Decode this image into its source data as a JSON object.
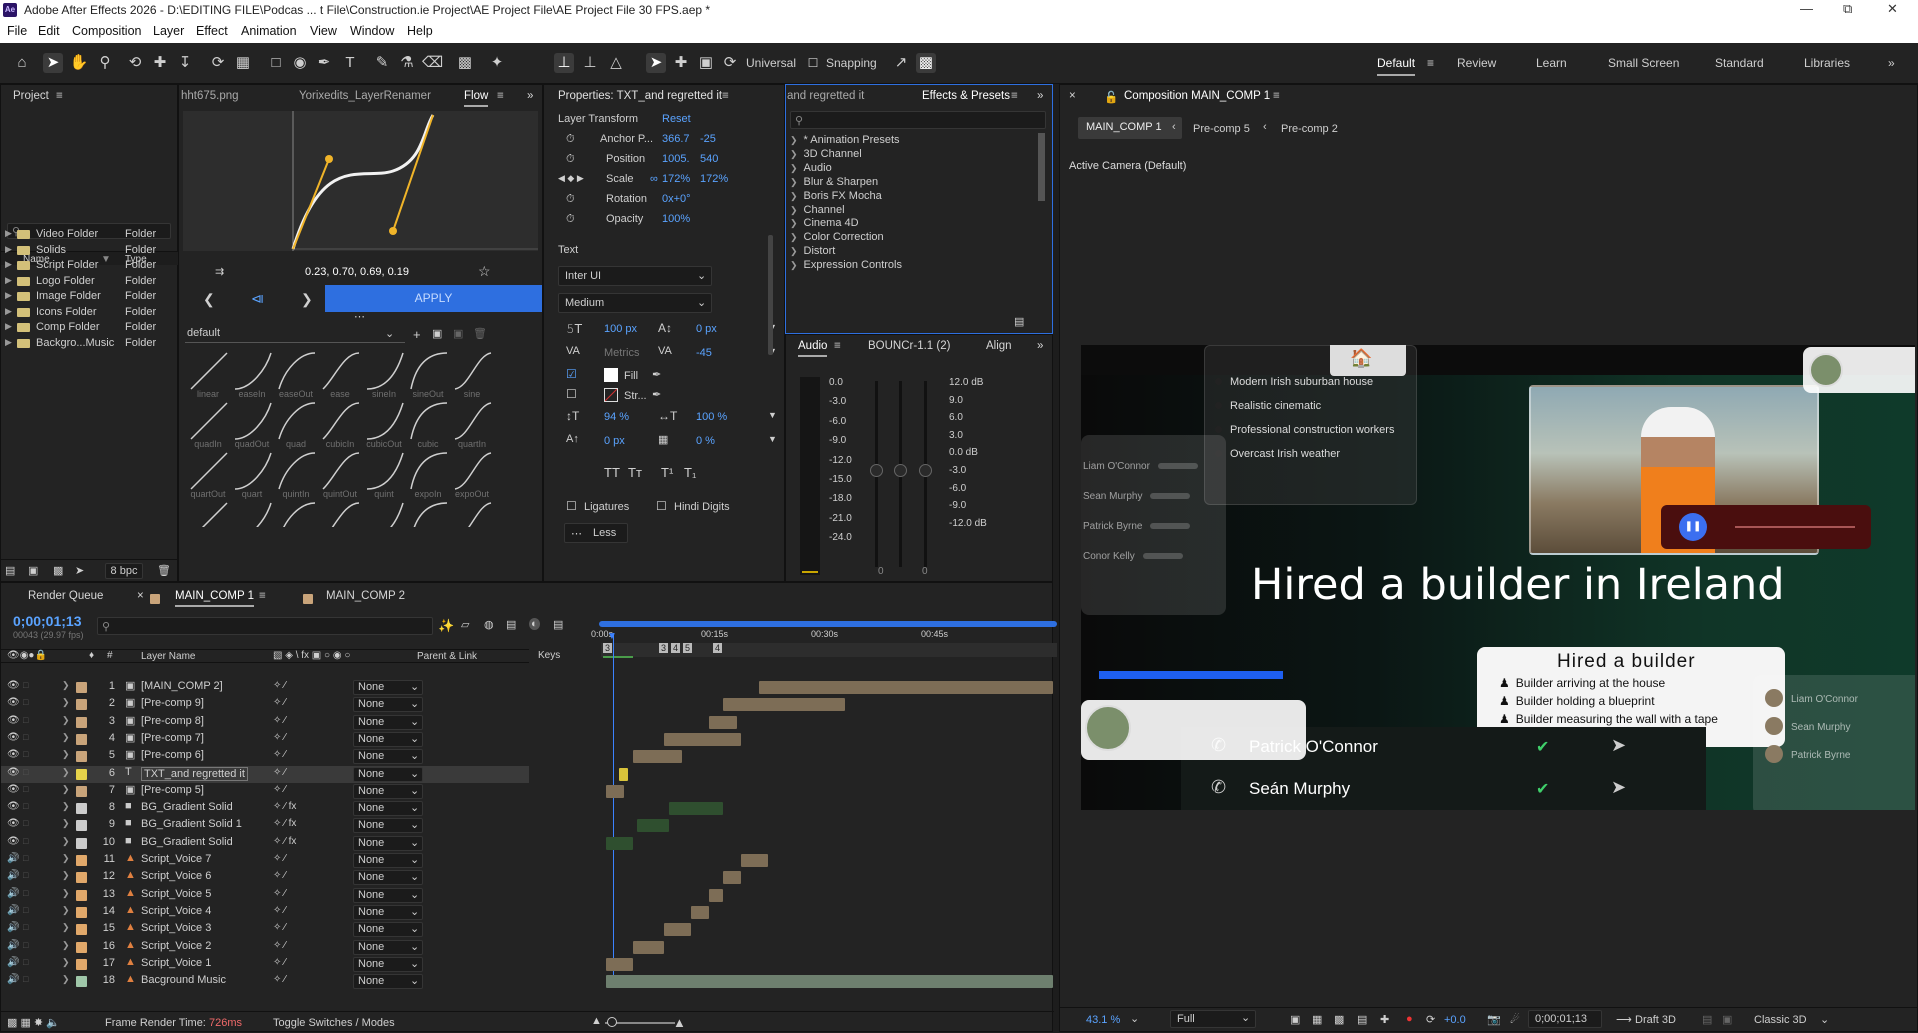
{
  "app": {
    "title": "Adobe After Effects 2026 - D:\\EDITING FILE\\Podcas ... t File\\Construction.ie Project\\AE Project File\\AE Project File 30 FPS.aep *",
    "logo": "Ae"
  },
  "menu": [
    "File",
    "Edit",
    "Composition",
    "Layer",
    "Effect",
    "Animation",
    "View",
    "Window",
    "Help"
  ],
  "toolbar": {
    "axis_mode": "Universal",
    "snapping_label": "Snapping",
    "workspaces": [
      "Default",
      "Review",
      "Learn",
      "Small Screen",
      "Standard",
      "Libraries"
    ],
    "active_workspace": "Default"
  },
  "project": {
    "title": "Project",
    "search_placeholder": "",
    "col_name": "Name",
    "col_type": "Type",
    "items": [
      {
        "name": "Video Folder",
        "type": "Folder"
      },
      {
        "name": "Solids",
        "type": "Folder"
      },
      {
        "name": "Script Folder",
        "type": "Folder"
      },
      {
        "name": "Logo Folder",
        "type": "Folder"
      },
      {
        "name": "Image Folder",
        "type": "Folder"
      },
      {
        "name": "Icons Folder",
        "type": "Folder"
      },
      {
        "name": "Comp Folder",
        "type": "Folder"
      },
      {
        "name": "Backgro...Music",
        "type": "Folder"
      }
    ],
    "bpc": "8 bpc"
  },
  "flow": {
    "tabs": [
      "hht675.png",
      "Yorixedits_LayerRenamer",
      "Flow"
    ],
    "active_tab": "Flow",
    "bezier_values": "0.23, 0.70, 0.69, 0.19",
    "apply_label": "APPLY",
    "preset_select": "default",
    "presets": [
      "linear",
      "easeIn",
      "easeOut",
      "ease",
      "sineIn",
      "sineOut",
      "sine",
      "quadIn",
      "quadOut",
      "quad",
      "cubicIn",
      "cubicOut",
      "cubic",
      "quartIn",
      "quartOut",
      "quart",
      "quintIn",
      "quintOut",
      "quint",
      "expoIn",
      "expoOut"
    ]
  },
  "properties": {
    "title": "Properties: TXT_and regretted it",
    "section": "Layer Transform",
    "reset_label": "Reset",
    "anchor_label": "Anchor P...",
    "anchor": [
      "366.7",
      "-25"
    ],
    "position_label": "Position",
    "position": [
      "1005.",
      "540"
    ],
    "scale_label": "Scale",
    "scale": [
      "172%",
      "172%"
    ],
    "rotation_label": "Rotation",
    "rotation": "0x+0°",
    "opacity_label": "Opacity",
    "opacity": "100%",
    "text_section": "Text",
    "font": "Inter UI",
    "weight": "Medium",
    "font_size": "100 px",
    "leading": "0 px",
    "kerning": "Metrics",
    "tracking": "-45",
    "fill_label": "Fill",
    "stroke_label": "Str...",
    "vscale": "94 %",
    "hscale": "100 %",
    "baseline": "0 px",
    "tsume": "0 %",
    "ligatures_label": "Ligatures",
    "hindi_digits_label": "Hindi Digits",
    "less_label": "Less",
    "style_buttons": [
      "TT",
      "Tт",
      "T¹",
      "T₁"
    ]
  },
  "effects": {
    "left_tab": "and regretted it",
    "title": "Effects & Presets",
    "categories": [
      "* Animation Presets",
      "3D Channel",
      "Audio",
      "Blur & Sharpen",
      "Boris FX Mocha",
      "Channel",
      "Cinema 4D",
      "Color Correction",
      "Distort",
      "Expression Controls"
    ]
  },
  "audio": {
    "title": "Audio",
    "tab2": "BOUNCr-1.1 (2)",
    "tab3": "Align",
    "left_scale": [
      "0.0",
      "-3.0",
      "-6.0",
      "-9.0",
      "-12.0",
      "-15.0",
      "-18.0",
      "-21.0",
      "-24.0"
    ],
    "right_scale": [
      "12.0 dB",
      "9.0",
      "6.0",
      "3.0",
      "0.0 dB",
      "-3.0",
      "-6.0",
      "-9.0",
      "-12.0 dB"
    ],
    "slider_bottom": [
      "0",
      "0"
    ]
  },
  "composition": {
    "title": "Composition MAIN_COMP 1",
    "breadcrumbs": [
      "MAIN_COMP 1",
      "Pre-comp 5",
      "Pre-comp 2"
    ],
    "camera": "Active Camera (Default)",
    "bullets": [
      "Modern Irish suburban house",
      "Realistic cinematic",
      "Professional construction workers",
      "Overcast Irish weather"
    ],
    "left_names": [
      "Liam O'Connor",
      "Sean Murphy",
      "Patrick Byrne",
      "Conor Kelly"
    ],
    "headline": "Hired a builder in Ireland",
    "card_title": "Hired a builder",
    "card_items": [
      "Builder arriving at the house",
      "Builder holding a blueprint",
      "Builder measuring the wall with a tape"
    ],
    "calls": [
      "Patrick O'Connor",
      "Seán Murphy"
    ],
    "right_names": [
      "Liam O'Connor",
      "Sean Murphy",
      "Patrick Byrne"
    ],
    "zoom": "43.1 %",
    "resolution": "Full",
    "exposure": "+0.0",
    "timecode": "0;00;01;13",
    "renderer": "Draft 3D",
    "mode": "Classic 3D",
    "colors": {
      "accent": "#1e5ff0",
      "bg_dark": "#0b1a17",
      "bg_green": "#0f3a2a"
    }
  },
  "timeline": {
    "tabs": [
      "Render Queue",
      "MAIN_COMP 1",
      "MAIN_COMP 2"
    ],
    "active_tab": "MAIN_COMP 1",
    "timecode": "0;00;01;13",
    "frames": "00043 (29.97 fps)",
    "col_layer_name": "Layer Name",
    "col_parent": "Parent & Link",
    "col_keys": "Keys",
    "ruler": [
      "0:00s",
      "00:15s",
      "00:30s",
      "00:45s"
    ],
    "layers": [
      {
        "num": "1",
        "name": "[MAIN_COMP 2]",
        "kind": "comp",
        "label": "#c9a47a",
        "parent": "None",
        "start": 0.35,
        "end": 1.0
      },
      {
        "num": "2",
        "name": "[Pre-comp 9]",
        "kind": "comp",
        "label": "#c9a47a",
        "parent": "None",
        "start": 0.27,
        "end": 0.54
      },
      {
        "num": "3",
        "name": "[Pre-comp 8]",
        "kind": "comp",
        "label": "#c9a47a",
        "parent": "None",
        "start": 0.24,
        "end": 0.3
      },
      {
        "num": "4",
        "name": "[Pre-comp 7]",
        "kind": "comp",
        "label": "#c9a47a",
        "parent": "None",
        "start": 0.14,
        "end": 0.31
      },
      {
        "num": "5",
        "name": "[Pre-comp 6]",
        "kind": "comp",
        "label": "#c9a47a",
        "parent": "None",
        "start": 0.07,
        "end": 0.18
      },
      {
        "num": "6",
        "name": "TXT_and regretted it",
        "kind": "text",
        "label": "#e6d34a",
        "parent": "None",
        "start": 0.04,
        "end": 0.06,
        "selected": true
      },
      {
        "num": "7",
        "name": "[Pre-comp 5]",
        "kind": "comp",
        "label": "#c9a47a",
        "parent": "None",
        "start": 0.01,
        "end": 0.05
      },
      {
        "num": "8",
        "name": "BG_Gradient Solid",
        "kind": "solid",
        "label": "#cccccc",
        "parent": "None",
        "start": 0.15,
        "end": 0.27
      },
      {
        "num": "9",
        "name": "BG_Gradient Solid 1",
        "kind": "solid",
        "label": "#cccccc",
        "parent": "None",
        "start": 0.08,
        "end": 0.15
      },
      {
        "num": "10",
        "name": "BG_Gradient Solid",
        "kind": "solid",
        "label": "#cccccc",
        "parent": "None",
        "start": 0.01,
        "end": 0.07
      },
      {
        "num": "11",
        "name": "Script_Voice 7",
        "kind": "audio",
        "label": "#e1a86a",
        "parent": "None",
        "start": 0.31,
        "end": 0.37
      },
      {
        "num": "12",
        "name": "Script_Voice 6",
        "kind": "audio",
        "label": "#e1a86a",
        "parent": "None",
        "start": 0.27,
        "end": 0.31
      },
      {
        "num": "13",
        "name": "Script_Voice 5",
        "kind": "audio",
        "label": "#e1a86a",
        "parent": "None",
        "start": 0.24,
        "end": 0.27
      },
      {
        "num": "14",
        "name": "Script_Voice 4",
        "kind": "audio",
        "label": "#e1a86a",
        "parent": "None",
        "start": 0.2,
        "end": 0.24
      },
      {
        "num": "15",
        "name": "Script_Voice 3",
        "kind": "audio",
        "label": "#e1a86a",
        "parent": "None",
        "start": 0.14,
        "end": 0.2
      },
      {
        "num": "16",
        "name": "Script_Voice 2",
        "kind": "audio",
        "label": "#e1a86a",
        "parent": "None",
        "start": 0.07,
        "end": 0.14
      },
      {
        "num": "17",
        "name": "Script_Voice 1",
        "kind": "audio",
        "label": "#e1a86a",
        "parent": "None",
        "start": 0.01,
        "end": 0.07
      },
      {
        "num": "18",
        "name": "Bacground Music",
        "kind": "audio",
        "label": "#9fc7a9",
        "parent": "None",
        "start": 0.01,
        "end": 1.0
      }
    ],
    "render_time_label": "Frame Render Time:",
    "render_time": "726ms",
    "toggle_label": "Toggle Switches / Modes"
  }
}
